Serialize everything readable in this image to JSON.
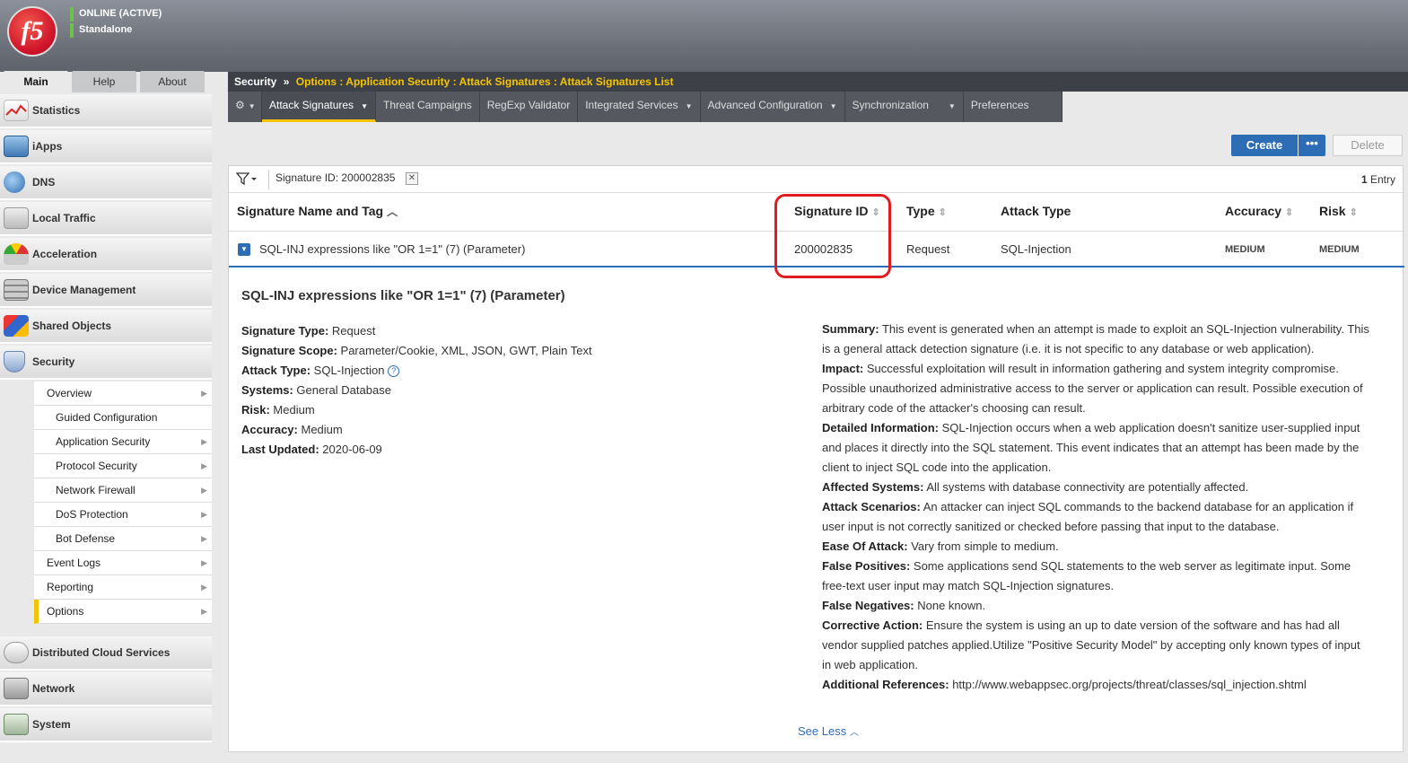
{
  "header": {
    "logo_text": "f5",
    "status_line1": "ONLINE (ACTIVE)",
    "status_line2": "Standalone",
    "status_color": "#6fc04b"
  },
  "top_tabs": [
    "Main",
    "Help",
    "About"
  ],
  "sidebar": {
    "items": [
      {
        "label": "Statistics",
        "icon": "statistics-icon"
      },
      {
        "label": "iApps",
        "icon": "iapps-icon"
      },
      {
        "label": "DNS",
        "icon": "dns-globe-icon"
      },
      {
        "label": "Local Traffic",
        "icon": "local-traffic-icon"
      },
      {
        "label": "Acceleration",
        "icon": "acceleration-gauge-icon"
      },
      {
        "label": "Device Management",
        "icon": "device-management-icon"
      },
      {
        "label": "Shared Objects",
        "icon": "shared-objects-icon"
      },
      {
        "label": "Security",
        "icon": "security-shield-icon"
      },
      {
        "label": "Distributed Cloud Services",
        "icon": "cloud-icon"
      },
      {
        "label": "Network",
        "icon": "network-icon"
      },
      {
        "label": "System",
        "icon": "system-icon"
      }
    ],
    "security_sub": [
      "Overview",
      "Guided Configuration",
      "Application Security",
      "Protocol Security",
      "Network Firewall",
      "DoS Protection",
      "Bot Defense",
      "Event Logs",
      "Reporting",
      "Options"
    ]
  },
  "breadcrumb": {
    "root": "Security",
    "sep": "»",
    "path": "Options : Application Security : Attack Signatures : Attack Signatures List"
  },
  "menubar": {
    "gear": "⚙",
    "items": [
      "Attack Signatures",
      "Threat Campaigns",
      "RegExp Validator",
      "Integrated Services",
      "Advanced Configuration",
      "Synchronization",
      "Preferences"
    ]
  },
  "actions": {
    "create": "Create",
    "more": "•••",
    "delete": "Delete"
  },
  "filter": {
    "chip": "Signature ID: 200002835",
    "entries_count": "1",
    "entries_label": " Entry"
  },
  "table": {
    "headers": [
      "Signature Name and Tag",
      "Signature ID",
      "Type",
      "Attack Type",
      "Accuracy",
      "Risk"
    ],
    "row": {
      "name": "SQL-INJ expressions like \"OR 1=1\" (7) (Parameter)",
      "id": "200002835",
      "type": "Request",
      "attack_type": "SQL-Injection",
      "accuracy": "MEDIUM",
      "risk": "MEDIUM"
    }
  },
  "detail": {
    "title": "SQL-INJ expressions like \"OR 1=1\" (7) (Parameter)",
    "left": [
      {
        "k": "Signature Type:",
        "v": " Request"
      },
      {
        "k": "Signature Scope:",
        "v": " Parameter/Cookie, XML, JSON, GWT, Plain Text"
      },
      {
        "k": "Attack Type:",
        "v": " SQL-Injection"
      },
      {
        "k": "Systems:",
        "v": " General Database"
      },
      {
        "k": "Risk:",
        "v": " Medium"
      },
      {
        "k": "Accuracy:",
        "v": " Medium"
      },
      {
        "k": "Last Updated:",
        "v": " 2020-06-09"
      }
    ],
    "right": [
      {
        "k": "Summary:",
        "v": " This event is generated when an attempt is made to exploit an SQL-Injection vulnerability. This is a general attack detection signature (i.e. it is not specific to any database or web application)."
      },
      {
        "k": "Impact:",
        "v": " Successful exploitation will result in information gathering and system integrity compromise. Possible unauthorized administrative access to the server or application can result. Possible execution of arbitrary code of the attacker's choosing can result."
      },
      {
        "k": "Detailed Information:",
        "v": " SQL-Injection occurs when a web application doesn't sanitize user-supplied input and places it directly into the SQL statement. This event indicates that an attempt has been made by the client to inject SQL code into the application."
      },
      {
        "k": "Affected Systems:",
        "v": " All systems with database connectivity are potentially affected."
      },
      {
        "k": "Attack Scenarios:",
        "v": " An attacker can inject SQL commands to the backend database for an application if user input is not correctly sanitized or checked before passing that input to the database."
      },
      {
        "k": "Ease Of Attack:",
        "v": " Vary from simple to medium."
      },
      {
        "k": "False Positives:",
        "v": " Some applications send SQL statements to the web server as legitimate input. Some free-text user input may match SQL-Injection signatures."
      },
      {
        "k": "False Negatives:",
        "v": " None known."
      },
      {
        "k": "Corrective Action:",
        "v": " Ensure the system is using an up to date version of the software and has had all vendor supplied patches applied.Utilize \"Positive Security Model\" by accepting only known types of input in web application."
      },
      {
        "k": "Additional References:",
        "v": " http://www.webappsec.org/projects/threat/classes/sql_injection.shtml"
      }
    ],
    "see_less": "See Less"
  },
  "colors": {
    "accent_blue": "#2c6db5",
    "highlight_red": "#e11b22",
    "active_yellow": "#f5c400"
  }
}
